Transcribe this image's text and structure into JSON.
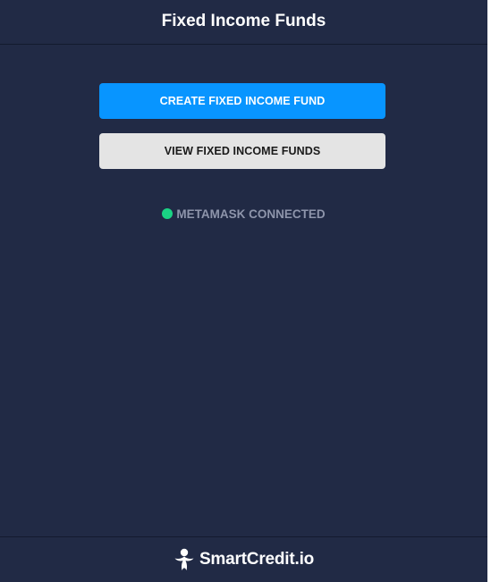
{
  "header": {
    "title": "Fixed Income Funds"
  },
  "actions": {
    "create_label": "CREATE FIXED INCOME FUND",
    "view_label": "VIEW FIXED INCOME FUNDS"
  },
  "status": {
    "text": "METAMASK CONNECTED",
    "indicator_color": "#1ad384"
  },
  "footer": {
    "brand_text": "SmartCredit.io",
    "brand_icon": "smartcredit-logo-icon"
  },
  "colors": {
    "background": "#212a45",
    "primary": "#0895ff",
    "secondary": "#e4e4e4"
  }
}
